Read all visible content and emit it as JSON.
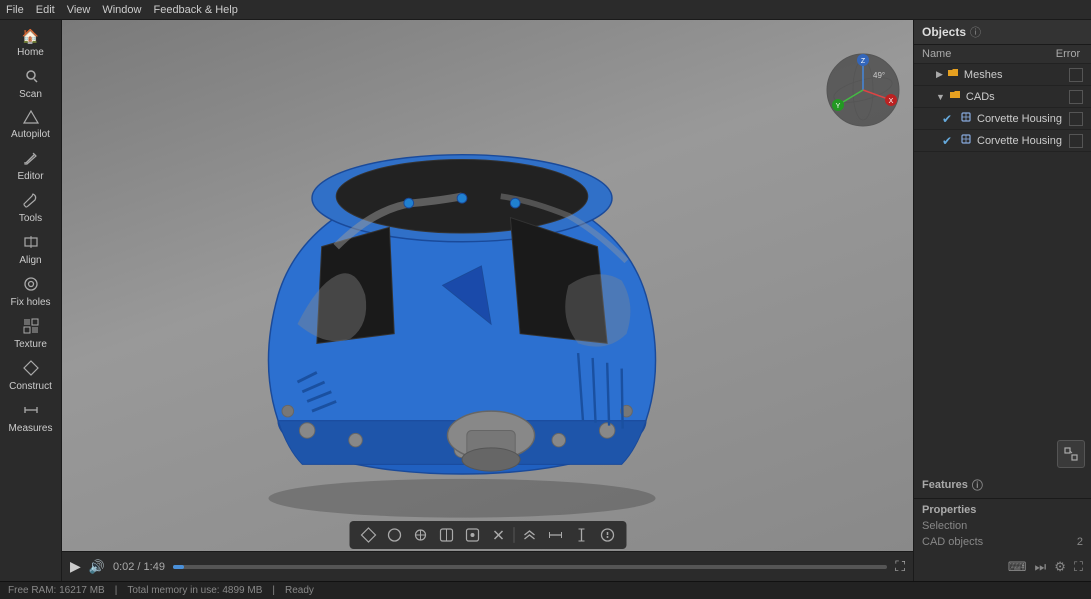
{
  "menu": {
    "items": [
      "File",
      "Edit",
      "View",
      "Window",
      "Feedback & Help"
    ]
  },
  "sidebar": {
    "items": [
      {
        "label": "Home",
        "icon": "🏠"
      },
      {
        "label": "Scan",
        "icon": "📷"
      },
      {
        "label": "Autopilot",
        "icon": "✈️"
      },
      {
        "label": "Editor",
        "icon": "✏️"
      },
      {
        "label": "Tools",
        "icon": "🔧"
      },
      {
        "label": "Align",
        "icon": "⬛"
      },
      {
        "label": "Fix holes",
        "icon": "◉"
      },
      {
        "label": "Texture",
        "icon": "🔲"
      },
      {
        "label": "Construct",
        "icon": "📐"
      },
      {
        "label": "Measures",
        "icon": "📏"
      }
    ]
  },
  "objects_panel": {
    "title": "Objects",
    "columns": {
      "name": "Name",
      "error": "Error"
    },
    "tree": [
      {
        "level": 0,
        "name": "Meshes",
        "checked": false,
        "type": "folder",
        "indent": 8
      },
      {
        "level": 0,
        "name": "CADs",
        "checked": false,
        "type": "folder",
        "indent": 8
      },
      {
        "level": 1,
        "name": "Corvette Housing",
        "checked": true,
        "type": "cad",
        "indent": 24
      },
      {
        "level": 1,
        "name": "Corvette Housing",
        "checked": true,
        "type": "cad",
        "indent": 24
      }
    ]
  },
  "features_panel": {
    "title": "Features"
  },
  "properties_panel": {
    "title": "Properties",
    "selection_label": "Selection",
    "cad_objects_label": "CAD objects",
    "cad_objects_value": "2"
  },
  "timeline": {
    "play_label": "▶",
    "time_current": "0:02",
    "time_total": "1:49",
    "time_display": "0:02 / 1:49",
    "volume_icon": "🔊",
    "expand_icon": "⛶"
  },
  "status_bar": {
    "ram_label": "Free RAM: 16217 MB",
    "memory_label": "Total memory in use: 4899 MB",
    "status": "Ready"
  },
  "bottom_toolbar": {
    "icons": [
      "⬡",
      "○",
      "⊕",
      "⊘",
      "⊖",
      "⊗",
      "▸",
      "⬟",
      "⬠",
      "◎",
      "⊚"
    ]
  },
  "gizmo": {
    "x_label": "X",
    "y_label": "Y",
    "z_label": "Z",
    "angle_label": "49°"
  }
}
